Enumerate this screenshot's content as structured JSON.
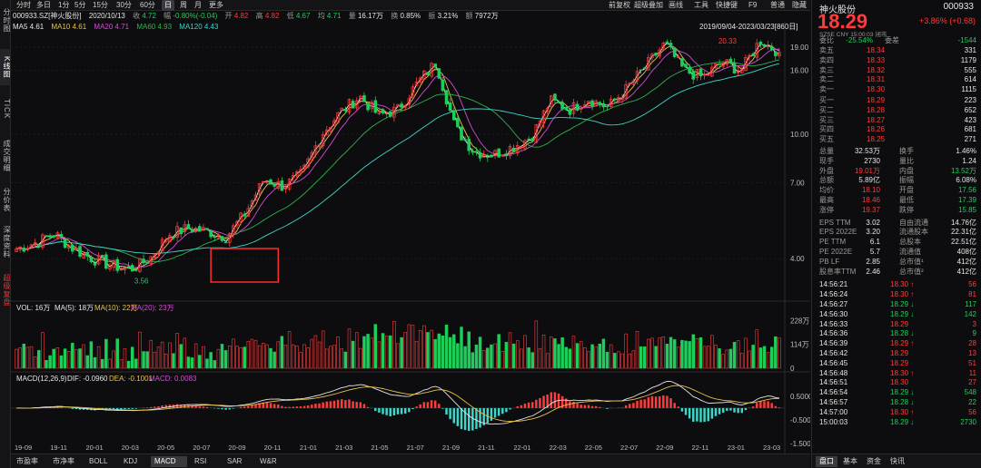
{
  "left_tabs": [
    {
      "label": "分时图",
      "active": false
    },
    {
      "label": "K线图",
      "active": true
    },
    {
      "label": "TICK",
      "active": false
    },
    {
      "label": "成交明细",
      "active": false
    },
    {
      "label": "分价表",
      "active": false
    },
    {
      "label": "深度资料",
      "active": false
    },
    {
      "label": "超级复盘",
      "active": false
    }
  ],
  "top_toolbar": {
    "periods": [
      "分时",
      "多日",
      "1分",
      "5分",
      "15分",
      "30分",
      "60分",
      "日",
      "周",
      "月",
      "更多"
    ],
    "selected_period": "日",
    "right_tools": [
      "前复权",
      "超级叠加",
      "画线",
      "工具",
      "快捷键",
      "F9",
      "普通",
      "隐藏"
    ]
  },
  "quote_line": {
    "code": "000933.SZ[神火股份]",
    "date": "2020/10/13",
    "close_label": "收",
    "close": "4.72",
    "change_label": "幅",
    "change": "-0.80%(-0.04)",
    "open_label": "开",
    "open": "4.82",
    "high_label": "高",
    "high": "4.82",
    "low_label": "低",
    "low": "4.67",
    "avg_label": "均",
    "avg": "4.71",
    "volume_label": "量",
    "volume": "16.17万",
    "turnover_label": "换",
    "turnover": "0.85%",
    "amplitude_label": "振",
    "amplitude": "3.21%",
    "amount_label": "额",
    "amount": "7972万"
  },
  "ma_line": {
    "ma5": "MA5 4.61",
    "ma10": "MA10 4.61",
    "ma20": "MA20 4.71",
    "ma60": "MA60 4.93",
    "ma120": "MA120 4.43"
  },
  "range_label": "2019/09/04-2023/03/23[860日]",
  "colors": {
    "up": "#ff3b3b",
    "down": "#1fce5a",
    "ma5": "#ffffff",
    "ma10": "#e6c34a",
    "ma20": "#d64bd6",
    "ma60": "#2fb24b",
    "ma120": "#3ed6c8",
    "highlight_box": "#ff2a2a"
  },
  "chart_data": [
    {
      "type": "line",
      "title": "000933 神火股份 日K",
      "series_note": "approximate closing-price path, candlesticks",
      "x_ticks": [
        "19-09",
        "19-11",
        "20-01",
        "20-03",
        "20-05",
        "20-07",
        "20-09",
        "20-11",
        "21-01",
        "21-03",
        "21-05",
        "21-07",
        "21-09",
        "21-11",
        "22-01",
        "22-03",
        "22-05",
        "22-07",
        "22-09",
        "22-11",
        "23-01",
        "23-03"
      ],
      "y_ticks": [
        "19.00",
        "16.00",
        "10.00",
        "7.00",
        "4.00"
      ],
      "y_scale": "log",
      "ylim": [
        3.3,
        22.0
      ],
      "max_label": "20.33",
      "min_label": "3.56",
      "x": [
        "19-09",
        "19-11",
        "20-01",
        "20-02",
        "20-03",
        "20-04",
        "20-05",
        "20-06",
        "20-07",
        "20-08",
        "20-09",
        "20-10",
        "20-11",
        "20-12",
        "21-01",
        "21-02",
        "21-03",
        "21-04",
        "21-05",
        "21-06",
        "21-07",
        "21-08",
        "21-09",
        "21-10",
        "21-11",
        "21-12",
        "22-01",
        "22-02",
        "22-03",
        "22-04",
        "22-05",
        "22-06",
        "22-07",
        "22-08",
        "22-09",
        "22-10",
        "22-11",
        "22-12",
        "23-01",
        "23-02",
        "23-03"
      ],
      "close": [
        4.3,
        4.5,
        4.8,
        4.3,
        4.0,
        3.8,
        3.7,
        4.0,
        4.8,
        5.0,
        4.9,
        4.7,
        5.6,
        7.2,
        6.8,
        7.5,
        10.0,
        11.8,
        13.2,
        11.5,
        12.0,
        14.5,
        17.0,
        10.5,
        8.8,
        8.6,
        9.1,
        9.8,
        12.8,
        12.0,
        13.0,
        12.2,
        14.0,
        16.5,
        19.5,
        16.0,
        15.2,
        17.0,
        16.0,
        20.0,
        18.29
      ]
    },
    {
      "type": "bar",
      "title": "VOL",
      "legend": "VOL: 16万 MA(5): 18万 MA(10): 22万 MA(20): 23万",
      "y_ticks": [
        "228万",
        "114万",
        "0"
      ],
      "ylim": [
        0,
        260
      ]
    },
    {
      "type": "bar",
      "title": "MACD(12,26,9)",
      "legend": "MACD(12,26,9) DIF: -0.0960 DEA: -0.1001 MACD: 0.0083",
      "y_ticks": [
        "0.5000",
        "-0.5000",
        "-1.5000"
      ],
      "ylim": [
        -1.7,
        1.0
      ]
    }
  ],
  "panels": {
    "vol_legend": {
      "name": "VOL: 16万",
      "ma5": "MA(5): 18万",
      "ma10": "MA(10): 22万",
      "ma20": "MA(20): 23万"
    },
    "macd_legend": {
      "name": "MACD(12,26,9)",
      "dif": "DIF: -0.0960",
      "dea": "DEA: -0.1001",
      "macd": "MACD: 0.0083"
    }
  },
  "bottom_tabs": [
    "市盈率",
    "市净率",
    "BOLL",
    "KDJ",
    "MACD",
    "RSI",
    "SAR",
    "W&R"
  ],
  "bottom_selected": "MACD",
  "stock": {
    "name": "神火股份",
    "code": "000933",
    "price": "18.29",
    "change": "+3.86% (+0.68)",
    "exchange": "SZSE",
    "currency": "CNY",
    "time": "15:00:03",
    "status": "闭市"
  },
  "order_ratio": {
    "label1": "委比",
    "val1": "-25.54%",
    "label2": "委差",
    "val2": "-1544"
  },
  "asks": [
    {
      "label": "卖五",
      "price": "18.34",
      "vol": "331"
    },
    {
      "label": "卖四",
      "price": "18.33",
      "vol": "1179"
    },
    {
      "label": "卖三",
      "price": "18.32",
      "vol": "555"
    },
    {
      "label": "卖二",
      "price": "18.31",
      "vol": "614"
    },
    {
      "label": "卖一",
      "price": "18.30",
      "vol": "1115"
    }
  ],
  "bids": [
    {
      "label": "买一",
      "price": "18.29",
      "vol": "223"
    },
    {
      "label": "买二",
      "price": "18.28",
      "vol": "652"
    },
    {
      "label": "买三",
      "price": "18.27",
      "vol": "423"
    },
    {
      "label": "买四",
      "price": "18.26",
      "vol": "681"
    },
    {
      "label": "买五",
      "price": "18.25",
      "vol": "271"
    }
  ],
  "stats": [
    {
      "l1": "总量",
      "v1": "32.53万",
      "c1": "white",
      "l2": "换手",
      "v2": "1.46%",
      "c2": "white"
    },
    {
      "l1": "现手",
      "v1": "2730",
      "c1": "white",
      "l2": "量比",
      "v2": "1.24",
      "c2": "white"
    },
    {
      "l1": "外盘",
      "v1": "19.01万",
      "c1": "red",
      "l2": "内盘",
      "v2": "13.52万",
      "c2": "green"
    },
    {
      "l1": "总额",
      "v1": "5.89亿",
      "c1": "white",
      "l2": "振幅",
      "v2": "6.08%",
      "c2": "white"
    },
    {
      "l1": "均价",
      "v1": "18.10",
      "c1": "red",
      "l2": "开盘",
      "v2": "17.56",
      "c2": "green"
    },
    {
      "l1": "最高",
      "v1": "18.46",
      "c1": "red",
      "l2": "最低",
      "v2": "17.39",
      "c2": "green"
    },
    {
      "l1": "涨停",
      "v1": "19.37",
      "c1": "red",
      "l2": "跌停",
      "v2": "15.85",
      "c2": "green"
    }
  ],
  "fundamentals": [
    {
      "l1": "EPS TTM",
      "v1": "3.02",
      "l2": "自由流通",
      "v2": "14.76亿"
    },
    {
      "l1": "EPS 2022E",
      "v1": "3.20",
      "l2": "流通股本",
      "v2": "22.31亿"
    },
    {
      "l1": "PE TTM",
      "v1": "6.1",
      "l2": "总股本",
      "v2": "22.51亿"
    },
    {
      "l1": "PE 2022E",
      "v1": "5.7",
      "l2": "流通值",
      "v2": "408亿"
    },
    {
      "l1": "PB LF",
      "v1": "2.85",
      "l2": "总市值¹",
      "v2": "412亿"
    },
    {
      "l1": "股息率TTM",
      "v1": "2.46",
      "l2": "总市值²",
      "v2": "412亿"
    }
  ],
  "ticks": [
    {
      "time": "14:56:21",
      "price": "18.30",
      "dir": "up",
      "vol": "56",
      "vc": "red"
    },
    {
      "time": "14:56:24",
      "price": "18.30",
      "dir": "up",
      "vol": "81",
      "vc": "red"
    },
    {
      "time": "14:56:27",
      "price": "18.29",
      "dir": "down",
      "vol": "117",
      "vc": "green"
    },
    {
      "time": "14:56:30",
      "price": "18.29",
      "dir": "down",
      "vol": "142",
      "vc": "green"
    },
    {
      "time": "14:56:33",
      "price": "18.29",
      "dir": "",
      "vol": "3",
      "vc": "red"
    },
    {
      "time": "14:56:36",
      "price": "18.28",
      "dir": "down",
      "vol": "9",
      "vc": "green"
    },
    {
      "time": "14:56:39",
      "price": "18.29",
      "dir": "up",
      "vol": "28",
      "vc": "red"
    },
    {
      "time": "14:56:42",
      "price": "18.29",
      "dir": "",
      "vol": "13",
      "vc": "red"
    },
    {
      "time": "14:56:45",
      "price": "18.29",
      "dir": "",
      "vol": "51",
      "vc": "red"
    },
    {
      "time": "14:56:48",
      "price": "18.30",
      "dir": "up",
      "vol": "11",
      "vc": "red"
    },
    {
      "time": "14:56:51",
      "price": "18.30",
      "dir": "",
      "vol": "27",
      "vc": "red"
    },
    {
      "time": "14:56:54",
      "price": "18.29",
      "dir": "down",
      "vol": "548",
      "vc": "green"
    },
    {
      "time": "14:56:57",
      "price": "18.28",
      "dir": "down",
      "vol": "22",
      "vc": "green"
    },
    {
      "time": "14:57:00",
      "price": "18.30",
      "dir": "up",
      "vol": "56",
      "vc": "red"
    },
    {
      "time": "15:00:03",
      "price": "18.29",
      "dir": "down",
      "vol": "2730",
      "vc": "green"
    }
  ],
  "rp_tabs": [
    "盘口",
    "基本",
    "资金",
    "快讯"
  ],
  "rp_selected": "盘口"
}
